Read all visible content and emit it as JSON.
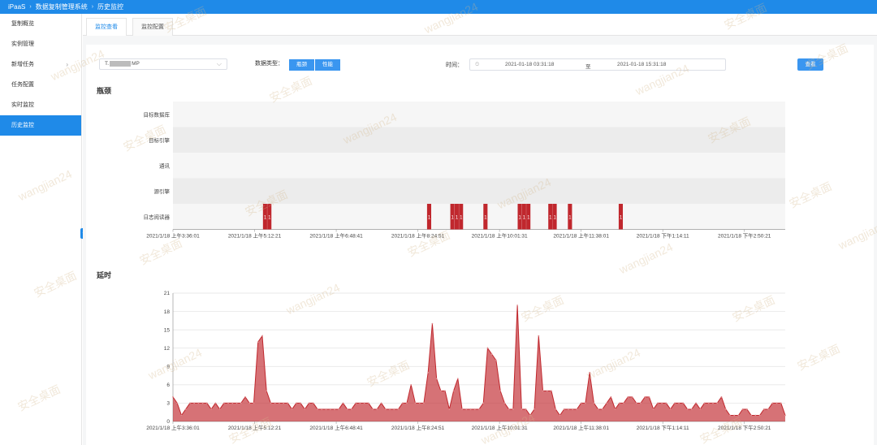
{
  "header": {
    "brand": "iPaaS",
    "system": "数据复制管理系统",
    "page": "历史监控"
  },
  "sidebar": {
    "items": [
      {
        "label": "复制概览",
        "active": false,
        "arrow": ""
      },
      {
        "label": "实例管理",
        "active": false,
        "arrow": ""
      },
      {
        "label": "新增任务",
        "active": false,
        "arrow": "›"
      },
      {
        "label": "任务配置",
        "active": false,
        "arrow": ""
      },
      {
        "label": "实时监控",
        "active": false,
        "arrow": ""
      },
      {
        "label": "历史监控",
        "active": true,
        "arrow": ""
      }
    ],
    "collapse_glyph": "‹"
  },
  "tabs": [
    {
      "label": "监控查看",
      "active": true
    },
    {
      "label": "监控配置",
      "active": false
    }
  ],
  "filters": {
    "instance_prefix": "T.",
    "instance_suffix": "MP",
    "instance_chevron": "⌵",
    "type_label": "数据类型：",
    "type_buttons": [
      "瓶颈",
      "性能"
    ],
    "time_label": "时间：",
    "clock_icon": "⏲",
    "start_time": "2021-01-18 03:31:18",
    "range_sep": "至",
    "end_time": "2021-01-18 15:31:18",
    "query_label": "查看"
  },
  "bottleneck": {
    "title": "瓶颈"
  },
  "latency": {
    "title": "延时"
  },
  "watermarks": [
    "安全桌面",
    "wangjian24"
  ],
  "chart_data": [
    {
      "type": "heatmap",
      "title": "瓶颈",
      "x_tick_labels": [
        "2021/1/18 上午3:36:01",
        "2021/1/18 上午5:12:21",
        "2021/1/18 上午6:48:41",
        "2021/1/18 上午8:24:51",
        "2021/1/18 上午10:01:31",
        "2021/1/18 上午11:38:01",
        "2021/1/18 下午1:14:11",
        "2021/1/18 下午2:50:21"
      ],
      "categories": [
        "目标数据库",
        "目标引擎",
        "通讯",
        "源引擎",
        "日志阅读器"
      ],
      "cell_color": "#c0272d",
      "cells": [
        {
          "category": "日志阅读器",
          "x": 0.147,
          "count": 2,
          "label": "1"
        },
        {
          "category": "日志阅读器",
          "x": 0.415,
          "count": 1,
          "label": "1"
        },
        {
          "category": "日志阅读器",
          "x": 0.453,
          "count": 3,
          "label": "1"
        },
        {
          "category": "日志阅读器",
          "x": 0.507,
          "count": 1,
          "label": "1"
        },
        {
          "category": "日志阅读器",
          "x": 0.563,
          "count": 3,
          "label": "1"
        },
        {
          "category": "日志阅读器",
          "x": 0.613,
          "count": 2,
          "label": "1"
        },
        {
          "category": "日志阅读器",
          "x": 0.645,
          "count": 1,
          "label": "1"
        },
        {
          "category": "日志阅读器",
          "x": 0.728,
          "count": 1,
          "label": "1"
        }
      ]
    },
    {
      "type": "area",
      "title": "延时",
      "x_tick_labels": [
        "2021/1/18 上午3:36:01",
        "2021/1/18 上午5:12:21",
        "2021/1/18 上午6:48:41",
        "2021/1/18 上午8:24:51",
        "2021/1/18 上午10:01:31",
        "2021/1/18 上午11:38:01",
        "2021/1/18 下午1:14:11",
        "2021/1/18 下午2:50:21"
      ],
      "y_ticks": [
        0,
        3,
        6,
        9,
        12,
        15,
        18,
        21
      ],
      "ylim": [
        0,
        21
      ],
      "grid": true,
      "series_color": "#c0272d",
      "series": [
        {
          "values": [
            4,
            3,
            1,
            2,
            3,
            3,
            3,
            3,
            3,
            2,
            3,
            2,
            3,
            3,
            3,
            3,
            3,
            4,
            3,
            3,
            13,
            14,
            5,
            3,
            3,
            3,
            3,
            3,
            2,
            3,
            3,
            2,
            3,
            3,
            2,
            2,
            2,
            2,
            2,
            2,
            3,
            2,
            2,
            3,
            3,
            3,
            3,
            2,
            2,
            3,
            2,
            2,
            2,
            2,
            3,
            3,
            6,
            3,
            3,
            3,
            8,
            16,
            7,
            5,
            5,
            2,
            5,
            7,
            2,
            2,
            2,
            2,
            2,
            3,
            12,
            11,
            10,
            5,
            3,
            2,
            2,
            19,
            2,
            2,
            1,
            2,
            14,
            5,
            5,
            5,
            2,
            1,
            2,
            2,
            2,
            2,
            3,
            3,
            8,
            3,
            2,
            2,
            3,
            4,
            2,
            3,
            3,
            4,
            4,
            3,
            3,
            4,
            4,
            2,
            3,
            3,
            3,
            2,
            3,
            3,
            3,
            2,
            2,
            3,
            2,
            3,
            3,
            3,
            3,
            4,
            2,
            1,
            1,
            1,
            2,
            2,
            1,
            1,
            1,
            2,
            2,
            3,
            3,
            3,
            1
          ]
        }
      ]
    }
  ]
}
